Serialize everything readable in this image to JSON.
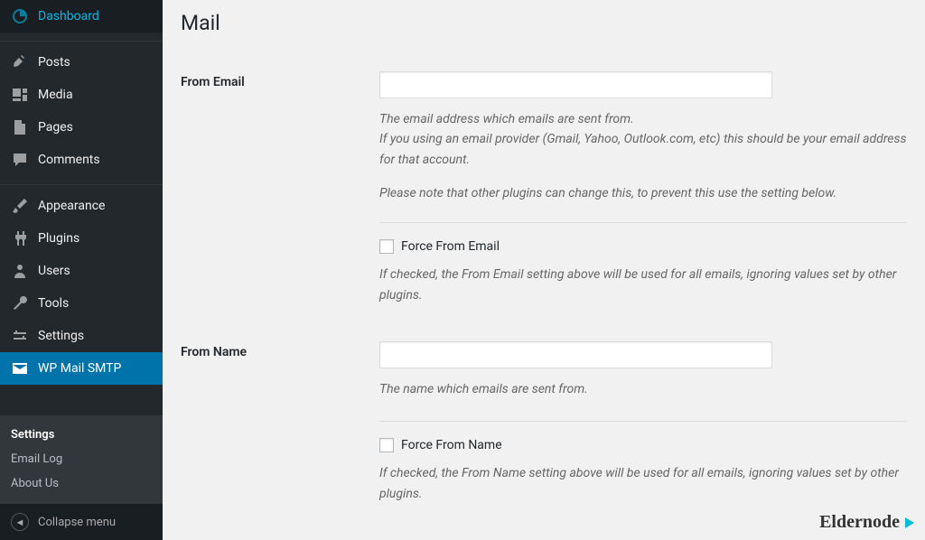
{
  "sidebar": {
    "items": [
      {
        "label": "Dashboard"
      },
      {
        "label": "Posts"
      },
      {
        "label": "Media"
      },
      {
        "label": "Pages"
      },
      {
        "label": "Comments"
      },
      {
        "label": "Appearance"
      },
      {
        "label": "Plugins"
      },
      {
        "label": "Users"
      },
      {
        "label": "Tools"
      },
      {
        "label": "Settings"
      },
      {
        "label": "WP Mail SMTP"
      }
    ],
    "submenu": [
      {
        "label": "Settings"
      },
      {
        "label": "Email Log"
      },
      {
        "label": "About Us"
      }
    ],
    "collapse": "Collapse menu"
  },
  "page": {
    "title": "Mail"
  },
  "form": {
    "fromEmail": {
      "label": "From Email",
      "value": "",
      "desc1": "The email address which emails are sent from.",
      "desc2": "If you using an email provider (Gmail, Yahoo, Outlook.com, etc) this should be your email address for that account.",
      "note": "Please note that other plugins can change this, to prevent this use the setting below.",
      "forceLabel": "Force From Email",
      "forceDesc": "If checked, the From Email setting above will be used for all emails, ignoring values set by other plugins."
    },
    "fromName": {
      "label": "From Name",
      "value": "",
      "desc": "The name which emails are sent from.",
      "forceLabel": "Force From Name",
      "forceDesc": "If checked, the From Name setting above will be used for all emails, ignoring values set by other plugins."
    }
  },
  "watermark": "Eldernode"
}
